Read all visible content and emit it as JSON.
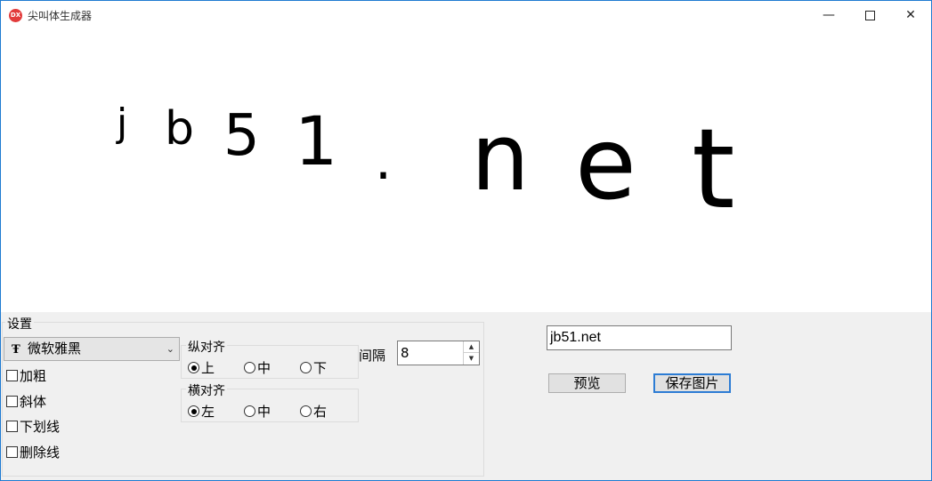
{
  "window": {
    "title": "尖叫体生成器",
    "app_icon_text": "DX",
    "minimize_glyph": "—",
    "close_glyph": "✕"
  },
  "canvas": {
    "chars": [
      "j",
      "b",
      "5",
      "1",
      ".",
      "n",
      "e",
      "t"
    ]
  },
  "settings": {
    "legend": "设置",
    "font_icon": "Ŧ",
    "font_selected": "微软雅黑",
    "checkboxes": [
      {
        "label": "加粗",
        "checked": false
      },
      {
        "label": "斜体",
        "checked": false
      },
      {
        "label": "下划线",
        "checked": false
      },
      {
        "label": "删除线",
        "checked": false
      }
    ],
    "vertical_align": {
      "legend": "纵对齐",
      "options": [
        "上",
        "中",
        "下"
      ],
      "selected": "上"
    },
    "horizontal_align": {
      "legend": "横对齐",
      "options": [
        "左",
        "中",
        "右"
      ],
      "selected": "左"
    },
    "gap": {
      "label": "间隔",
      "value": "8"
    }
  },
  "right_panel": {
    "text_value": "jb51.net",
    "preview_label": "预览",
    "save_label": "保存图片"
  }
}
